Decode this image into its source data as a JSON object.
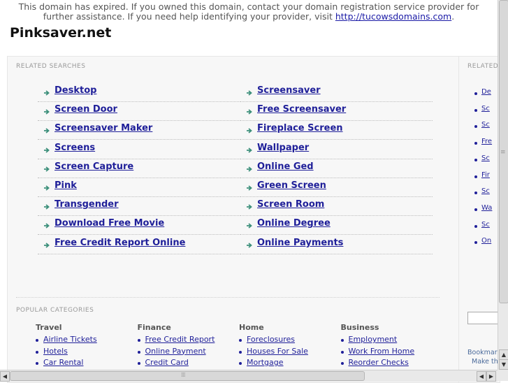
{
  "notice": {
    "text": "This domain has expired. If you owned this domain, contact your domain registration service provider for further assistance. If you need help identifying your provider, visit ",
    "link": "http://tucowsdomains.com",
    "trailing": "."
  },
  "site_title": "Pinksaver.net",
  "related_searches": {
    "label": "RELATED SEARCHES",
    "left_column": [
      "Desktop",
      "Screen Door",
      "Screensaver Maker",
      "Screens",
      "Screen Capture",
      "Pink",
      "Transgender",
      "Download Free Movie",
      "Free Credit Report Online"
    ],
    "right_column": [
      "Screensaver",
      "Free Screensaver",
      "Fireplace Screen",
      "Wallpaper",
      "Online Ged",
      "Green Screen",
      "Screen Room",
      "Online Degree",
      "Online Payments"
    ]
  },
  "popular_categories": {
    "label": "POPULAR CATEGORIES",
    "columns": [
      {
        "heading": "Travel",
        "links": [
          "Airline Tickets",
          "Hotels",
          "Car Rental"
        ]
      },
      {
        "heading": "Finance",
        "links": [
          "Free Credit Report",
          "Online Payment",
          "Credit Card"
        ]
      },
      {
        "heading": "Home",
        "links": [
          "Foreclosures",
          "Houses For Sale",
          "Mortgage"
        ]
      },
      {
        "heading": "Business",
        "links": [
          "Employment",
          "Work From Home",
          "Reorder Checks"
        ]
      }
    ]
  },
  "sidebar": {
    "label": "RELATED",
    "items": [
      "De",
      "Sc",
      "Sc",
      "Fre",
      "Sc",
      "Fir",
      "Sc",
      "Wa",
      "Sc",
      "On"
    ],
    "bookmark_text": "Bookmark",
    "make_text": "Make th"
  },
  "colors": {
    "link": "#1f1f99",
    "arrow": "#3b8f7a",
    "panel": "#f7f7f7"
  }
}
